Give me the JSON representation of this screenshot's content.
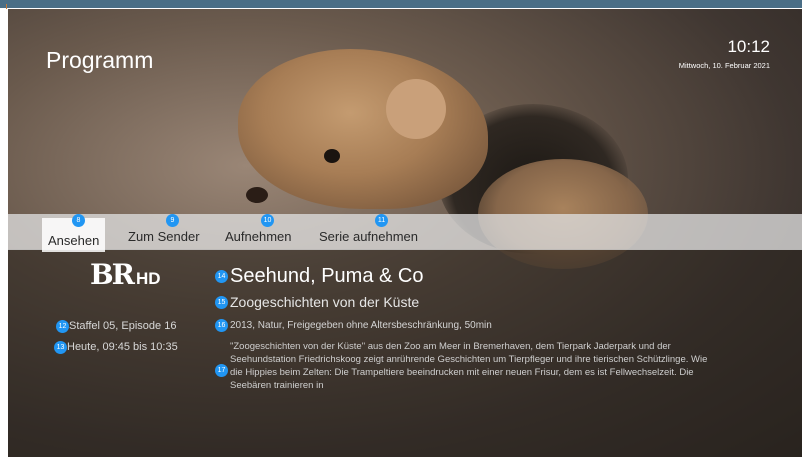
{
  "header": {
    "title": "Programm",
    "time": "10:12",
    "date": "Mittwoch, 10. Februar 2021"
  },
  "actions": [
    {
      "label": "Ansehen",
      "badge": "8",
      "selected": true
    },
    {
      "label": "Zum Sender",
      "badge": "9",
      "selected": false
    },
    {
      "label": "Aufnehmen",
      "badge": "10",
      "selected": false
    },
    {
      "label": "Serie aufnehmen",
      "badge": "11",
      "selected": false
    }
  ],
  "channel": {
    "logo_main": "BR",
    "logo_suffix": "HD"
  },
  "details": {
    "episode": "Staffel 05, Episode 16",
    "episode_badge": "12",
    "airtime": "Heute, 09:45 bis 10:35",
    "airtime_badge": "13",
    "show_title": "Seehund, Puma & Co",
    "show_title_badge": "14",
    "subtitle": "Zoogeschichten von der Küste",
    "subtitle_badge": "15",
    "info": "2013, Natur, Freigegeben ohne Altersbeschränkung, 50min",
    "info_badge": "16",
    "description": "\"Zoogeschichten von der Küste\" aus den Zoo am Meer in Bremerhaven, dem Tierpark Jaderpark und der Seehundstation Friedrichskoog zeigt anrührende Geschichten um Tierpfleger und ihre tierischen Schützlinge. Wie die Hippies beim Zelten: Die Trampeltiere beeindrucken mit einer neuen Frisur, dem es ist Fellwechselzeit. Die Seebären trainieren in",
    "description_badge": "17"
  },
  "colors": {
    "badge": "#2196f3",
    "topbar": "#4a6e86"
  }
}
